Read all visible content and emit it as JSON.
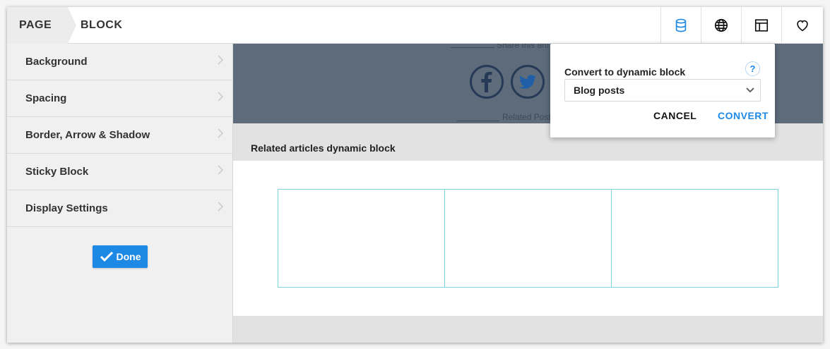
{
  "breadcrumb": {
    "page": "PAGE",
    "block": "BLOCK"
  },
  "toolbar_icons": [
    "database-icon",
    "globe-icon",
    "layout-icon",
    "heart-icon"
  ],
  "sidebar": {
    "items": [
      {
        "label": "Background"
      },
      {
        "label": "Spacing"
      },
      {
        "label": "Border, Arrow & Shadow"
      },
      {
        "label": "Sticky Block"
      },
      {
        "label": "Display Settings"
      }
    ],
    "done_label": "Done"
  },
  "preview": {
    "share_text": "Share this arti",
    "related_text": "Related Post",
    "social_icons": [
      "facebook-icon",
      "twitter-icon"
    ]
  },
  "main": {
    "related_label": "Related articles dynamic block"
  },
  "popover": {
    "title": "Convert to dynamic block",
    "help": "?",
    "select_value": "Blog posts",
    "cancel_label": "CANCEL",
    "convert_label": "CONVERT"
  },
  "colors": {
    "accent": "#1e88e5",
    "preview_bg": "#5d6b7a",
    "grid_border": "#7fd3de"
  }
}
